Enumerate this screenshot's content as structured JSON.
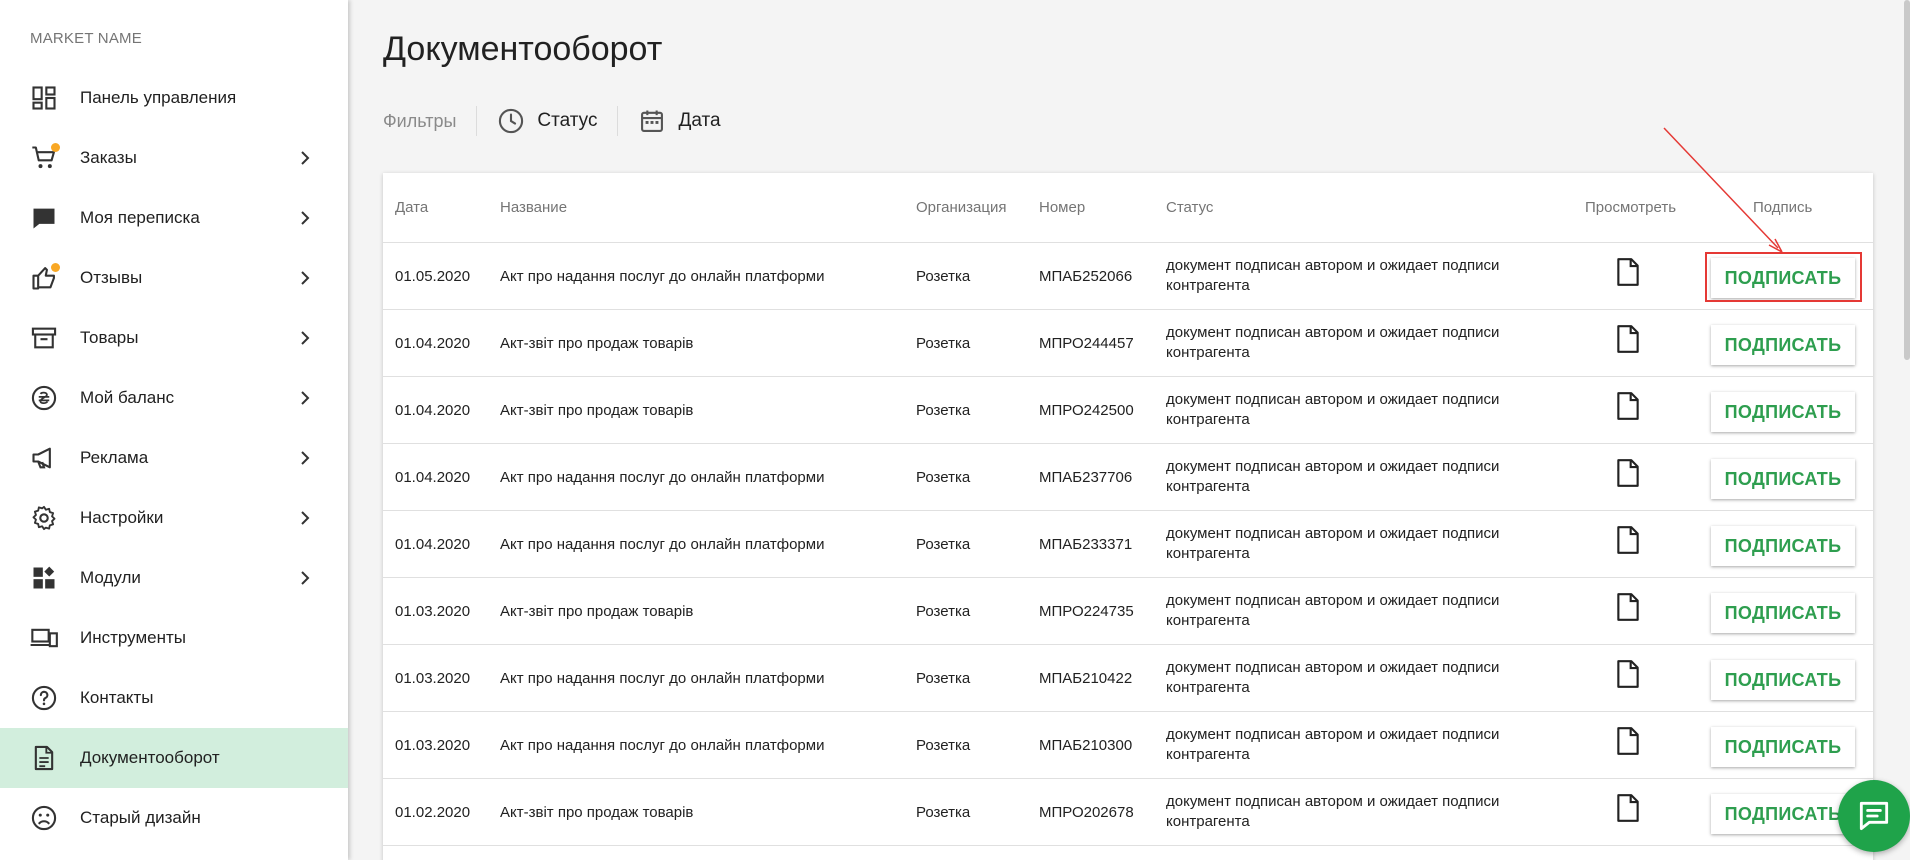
{
  "sidebar": {
    "market_name": "MARKET NAME",
    "items": [
      {
        "label": "Панель управления",
        "icon": "dashboard-icon",
        "chevron": false,
        "badge": false
      },
      {
        "label": "Заказы",
        "icon": "cart-icon",
        "chevron": true,
        "badge": true
      },
      {
        "label": "Моя переписка",
        "icon": "chat-bubble-icon",
        "chevron": true,
        "badge": false
      },
      {
        "label": "Отзывы",
        "icon": "thumb-up-icon",
        "chevron": true,
        "badge": true
      },
      {
        "label": "Товары",
        "icon": "archive-box-icon",
        "chevron": true,
        "badge": false
      },
      {
        "label": "Мой баланс",
        "icon": "hryvnia-coin-icon",
        "chevron": true,
        "badge": false
      },
      {
        "label": "Реклама",
        "icon": "megaphone-icon",
        "chevron": true,
        "badge": false
      },
      {
        "label": "Настройки",
        "icon": "gear-icon",
        "chevron": true,
        "badge": false
      },
      {
        "label": "Модули",
        "icon": "widgets-icon",
        "chevron": true,
        "badge": false
      },
      {
        "label": "Инструменты",
        "icon": "devices-icon",
        "chevron": false,
        "badge": false
      },
      {
        "label": "Контакты",
        "icon": "help-circle-icon",
        "chevron": false,
        "badge": false
      },
      {
        "label": "Документооборот",
        "icon": "document-icon",
        "chevron": false,
        "badge": false,
        "active": true
      },
      {
        "label": "Старый дизайн",
        "icon": "sad-face-icon",
        "chevron": false,
        "badge": false
      }
    ]
  },
  "page": {
    "title": "Документооборот"
  },
  "filters": {
    "label": "Фильтры",
    "status": "Статус",
    "date": "Дата"
  },
  "table": {
    "headers": {
      "date": "Дата",
      "name": "Название",
      "org": "Организация",
      "number": "Номер",
      "status": "Статус",
      "view": "Просмотреть",
      "sign": "Подпись"
    },
    "sign_label": "ПОДПИСАТЬ",
    "rows": [
      {
        "date": "01.05.2020",
        "name": "Акт про надання послуг до онлайн платформи",
        "org": "Розетка",
        "number": "МПАБ252066",
        "status": "документ подписан автором и ожидает подписи контрагента"
      },
      {
        "date": "01.04.2020",
        "name": "Акт-звіт про продаж товарів",
        "org": "Розетка",
        "number": "МПРО244457",
        "status": "документ подписан автором и ожидает подписи контрагента"
      },
      {
        "date": "01.04.2020",
        "name": "Акт-звіт про продаж товарів",
        "org": "Розетка",
        "number": "МПРО242500",
        "status": "документ подписан автором и ожидает подписи контрагента"
      },
      {
        "date": "01.04.2020",
        "name": "Акт про надання послуг до онлайн платформи",
        "org": "Розетка",
        "number": "МПАБ237706",
        "status": "документ подписан автором и ожидает подписи контрагента"
      },
      {
        "date": "01.04.2020",
        "name": "Акт про надання послуг до онлайн платформи",
        "org": "Розетка",
        "number": "МПАБ233371",
        "status": "документ подписан автором и ожидает подписи контрагента"
      },
      {
        "date": "01.03.2020",
        "name": "Акт-звіт про продаж товарів",
        "org": "Розетка",
        "number": "МПРО224735",
        "status": "документ подписан автором и ожидает подписи контрагента"
      },
      {
        "date": "01.03.2020",
        "name": "Акт про надання послуг до онлайн платформи",
        "org": "Розетка",
        "number": "МПАБ210422",
        "status": "документ подписан автором и ожидает подписи контрагента"
      },
      {
        "date": "01.03.2020",
        "name": "Акт про надання послуг до онлайн платформи",
        "org": "Розетка",
        "number": "МПАБ210300",
        "status": "документ подписан автором и ожидает подписи контрагента"
      },
      {
        "date": "01.02.2020",
        "name": "Акт-звіт про продаж товарів",
        "org": "Розетка",
        "number": "МПРО202678",
        "status": "документ подписан автором и ожидает подписи контрагента"
      }
    ]
  },
  "colors": {
    "accent_green": "#2e9e4f",
    "active_bg": "#d2eedd",
    "highlight_red": "#e53935",
    "badge_yellow": "#f9a825"
  }
}
